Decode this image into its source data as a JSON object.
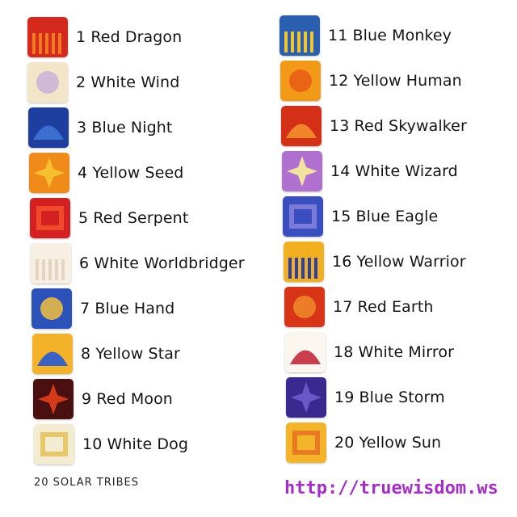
{
  "tribes_left": [
    {
      "label": "1 Red Dragon",
      "icon": "red-dragon-glyph-icon",
      "colors": [
        "#d42a1e",
        "#f07a20"
      ]
    },
    {
      "label": "2 White Wind",
      "icon": "white-wind-glyph-icon",
      "colors": [
        "#f3e6c8",
        "#c8b0d8"
      ]
    },
    {
      "label": "3 Blue Night",
      "icon": "blue-night-glyph-icon",
      "colors": [
        "#1f3fa0",
        "#3a6ed0"
      ]
    },
    {
      "label": "4 Yellow Seed",
      "icon": "yellow-seed-glyph-icon",
      "colors": [
        "#f08a18",
        "#f6c030"
      ]
    },
    {
      "label": "5 Red Serpent",
      "icon": "red-serpent-glyph-icon",
      "colors": [
        "#d42020",
        "#f04a2a"
      ]
    },
    {
      "label": "6 White Worldbridger",
      "icon": "white-worldbridger-glyph-icon",
      "colors": [
        "#f6efe2",
        "#e2d6c2"
      ]
    },
    {
      "label": "7 Blue Hand",
      "icon": "blue-hand-glyph-icon",
      "colors": [
        "#2a52b8",
        "#f2c040"
      ]
    },
    {
      "label": "8 Yellow Star",
      "icon": "yellow-star-glyph-icon",
      "colors": [
        "#f3b22a",
        "#3a62c0"
      ]
    },
    {
      "label": "9 Red Moon",
      "icon": "red-moon-glyph-icon",
      "colors": [
        "#4a1010",
        "#d23a1a"
      ]
    },
    {
      "label": "10 White Dog",
      "icon": "white-dog-glyph-icon",
      "colors": [
        "#f4ecd0",
        "#e6c86a"
      ]
    }
  ],
  "tribes_right": [
    {
      "label": "11 Blue Monkey",
      "icon": "blue-monkey-glyph-icon",
      "colors": [
        "#2a5fb0",
        "#f2c42e"
      ]
    },
    {
      "label": "12 Yellow Human",
      "icon": "yellow-human-glyph-icon",
      "colors": [
        "#f29a18",
        "#e85a14"
      ]
    },
    {
      "label": "13 Red Skywalker",
      "icon": "red-skywalker-glyph-icon",
      "colors": [
        "#d43018",
        "#f08428"
      ]
    },
    {
      "label": "14 White Wizard",
      "icon": "white-wizard-glyph-icon",
      "colors": [
        "#b070d0",
        "#f2e2a0"
      ]
    },
    {
      "label": "15 Blue Eagle",
      "icon": "blue-eagle-glyph-icon",
      "colors": [
        "#3a4ec0",
        "#7a7ad8"
      ]
    },
    {
      "label": "16 Yellow Warrior",
      "icon": "yellow-warrior-glyph-icon",
      "colors": [
        "#f2b020",
        "#2a40a8"
      ]
    },
    {
      "label": "17 Red Earth",
      "icon": "red-earth-glyph-icon",
      "colors": [
        "#d83418",
        "#f08a2a"
      ]
    },
    {
      "label": "18 White Mirror",
      "icon": "white-mirror-glyph-icon",
      "colors": [
        "#fbf6f0",
        "#c84050"
      ]
    },
    {
      "label": "19 Blue Storm",
      "icon": "blue-storm-glyph-icon",
      "colors": [
        "#3a2a90",
        "#6a58c8"
      ]
    },
    {
      "label": "20    Yellow Sun",
      "icon": "yellow-sun-glyph-icon",
      "colors": [
        "#f4b42a",
        "#e87a24"
      ]
    }
  ],
  "caption": "20 SOLAR TRIBES",
  "site_link": "http://truewisdom.ws",
  "link_color": "#a62cc8"
}
